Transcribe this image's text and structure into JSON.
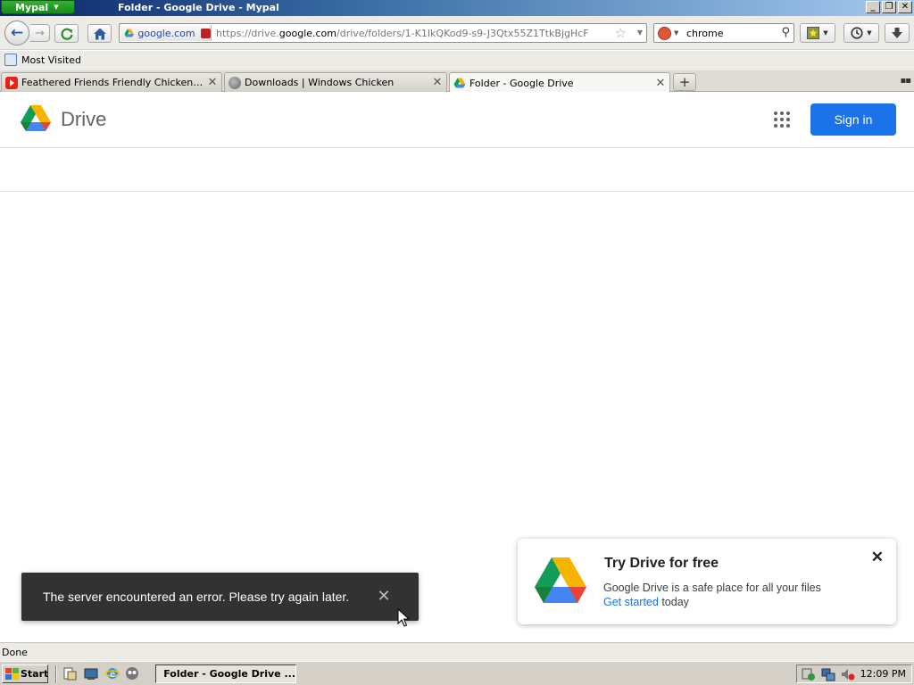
{
  "window": {
    "app_menu_label": "Mypal",
    "title": "Folder - Google Drive - Mypal",
    "controls": {
      "minimize": "_",
      "restore": "❐",
      "close": "✕"
    }
  },
  "nav": {
    "site_identity": "google.com",
    "url_prefix": "https://drive.",
    "url_domain": "google.com",
    "url_path": "/drive/folders/1-K1IkQKod9-s9-J3Qtx55Z1TtkBjgHcF",
    "search_value": "chrome"
  },
  "bookmarks": [
    {
      "label": "Most Visited"
    }
  ],
  "tabs": [
    {
      "label": "Feathered Friends Friendly Chickens - Yo...",
      "favicon": "youtube-icon",
      "active": false
    },
    {
      "label": "Downloads | Windows Chicken",
      "favicon": "globe-icon",
      "active": false
    },
    {
      "label": "Folder - Google Drive",
      "favicon": "google-drive-icon",
      "active": true
    }
  ],
  "page": {
    "product_name": "Drive",
    "sign_in_label": "Sign in",
    "snackbar_message": "The server encountered an error. Please try again later.",
    "promo": {
      "title": "Try Drive for free",
      "text": "Google Drive is a safe place for all your files",
      "link_label": "Get started",
      "link_suffix": " today"
    }
  },
  "status": {
    "text": "Done"
  },
  "taskbar": {
    "start_label": "Start",
    "task_label": "Folder - Google Drive ...",
    "clock": "12:09 PM"
  },
  "colors": {
    "accent_blue": "#1a73e8",
    "snackbar_bg": "#323232",
    "drive_green": "#0f9d58",
    "drive_yellow": "#f4b400",
    "drive_blue": "#4285f4",
    "drive_red": "#db4437"
  }
}
